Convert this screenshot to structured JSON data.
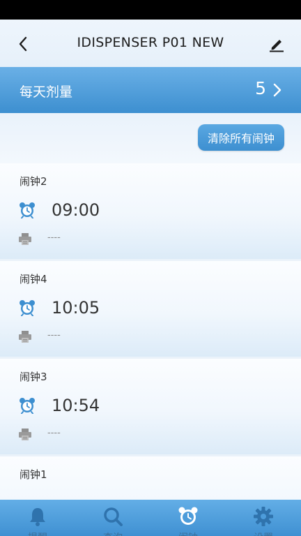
{
  "header": {
    "title": "IDISPENSER P01 NEW"
  },
  "dose": {
    "label": "每天剂量",
    "value": "5"
  },
  "actions": {
    "clear_all_label": "清除所有闹钟"
  },
  "alarms": [
    {
      "name": "闹钟2",
      "time": "09:00",
      "detail": "----"
    },
    {
      "name": "闹钟4",
      "time": "10:05",
      "detail": "----"
    },
    {
      "name": "闹钟3",
      "time": "10:54",
      "detail": "----"
    },
    {
      "name": "闹钟1",
      "time": "",
      "detail": ""
    }
  ],
  "nav": {
    "items": [
      {
        "label": "提醒",
        "icon": "bell-icon"
      },
      {
        "label": "查询",
        "icon": "search-icon"
      },
      {
        "label": "闹钟",
        "icon": "alarm-clock-icon",
        "active": true
      },
      {
        "label": "设置",
        "icon": "gear-icon"
      }
    ]
  },
  "colors": {
    "accent": "#3d8fd0",
    "accent_light": "#6ab0e6",
    "icon_blue": "#3d8fd0",
    "nav_active_icon": "#ffffff",
    "nav_inactive_icon": "#2f73ad"
  }
}
